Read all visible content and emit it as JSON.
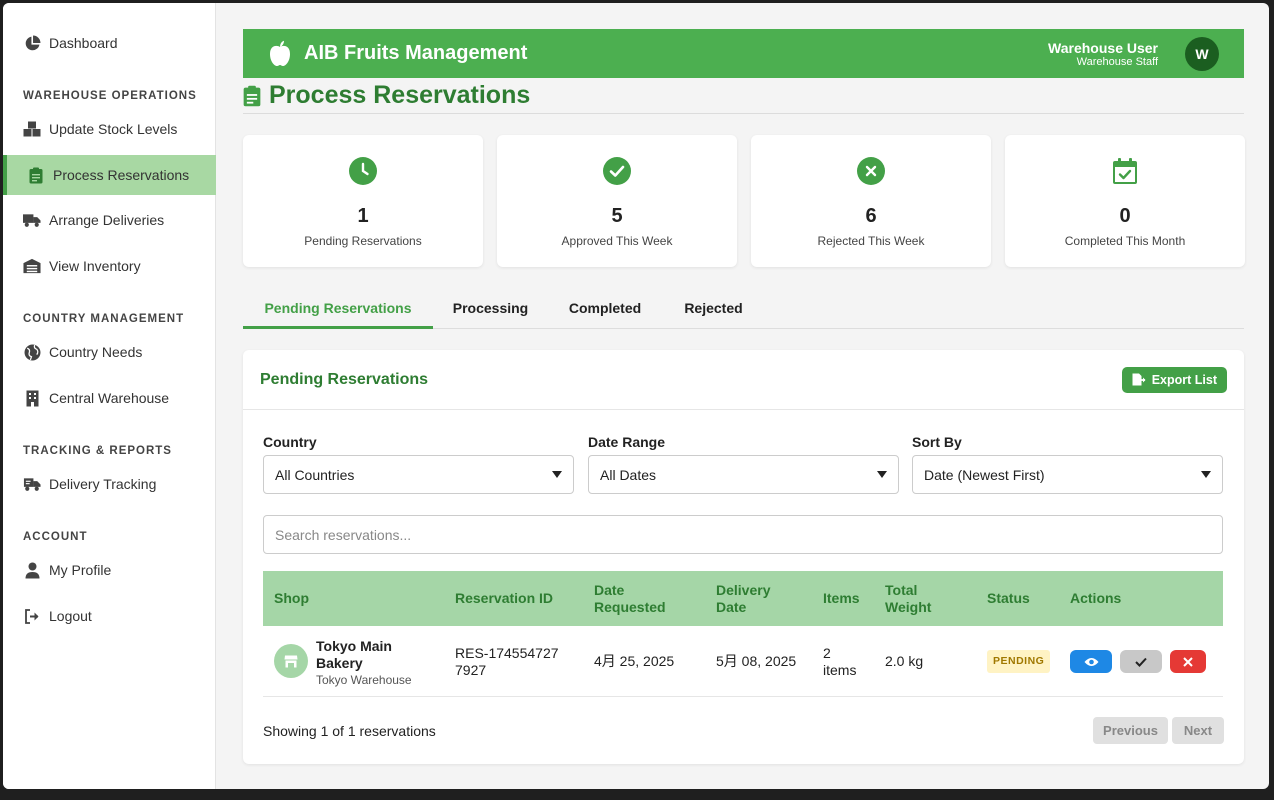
{
  "sidebar": {
    "items": [
      {
        "label": "Dashboard",
        "icon": "pie-chart-icon"
      },
      {
        "label": "Update Stock Levels",
        "icon": "boxes-icon"
      },
      {
        "label": "Process Reservations",
        "icon": "clipboard-icon"
      },
      {
        "label": "Arrange Deliveries",
        "icon": "truck-icon"
      },
      {
        "label": "View Inventory",
        "icon": "warehouse-icon"
      },
      {
        "label": "Country Needs",
        "icon": "globe-icon"
      },
      {
        "label": "Central Warehouse",
        "icon": "building-icon"
      },
      {
        "label": "Delivery Tracking",
        "icon": "truck-fast-icon"
      },
      {
        "label": "My Profile",
        "icon": "user-icon"
      },
      {
        "label": "Logout",
        "icon": "logout-icon"
      }
    ],
    "sections": [
      "WAREHOUSE OPERATIONS",
      "COUNTRY MANAGEMENT",
      "TRACKING & REPORTS",
      "ACCOUNT"
    ],
    "active_index": 2
  },
  "header": {
    "brand": "AIB Fruits Management",
    "user_name": "Warehouse User",
    "user_role": "Warehouse Staff",
    "avatar_letter": "W"
  },
  "page": {
    "title": "Process Reservations"
  },
  "stats": [
    {
      "value": "1",
      "label": "Pending Reservations",
      "icon": "clock-icon"
    },
    {
      "value": "5",
      "label": "Approved This Week",
      "icon": "check-circle-icon"
    },
    {
      "value": "6",
      "label": "Rejected This Week",
      "icon": "x-circle-icon"
    },
    {
      "value": "0",
      "label": "Completed This Month",
      "icon": "calendar-check-icon"
    }
  ],
  "tabs": [
    "Pending Reservations",
    "Processing",
    "Completed",
    "Rejected"
  ],
  "card": {
    "title": "Pending Reservations",
    "export_label": "Export List"
  },
  "filters": {
    "country_label": "Country",
    "country_value": "All Countries",
    "date_label": "Date Range",
    "date_value": "All Dates",
    "sort_label": "Sort By",
    "sort_value": "Date (Newest First)"
  },
  "search": {
    "placeholder": "Search reservations..."
  },
  "table": {
    "headers": [
      "Shop",
      "Reservation ID",
      "Date Requested",
      "Delivery Date",
      "Items",
      "Total Weight",
      "Status",
      "Actions"
    ],
    "rows": [
      {
        "shop_name": "Tokyo Main Bakery",
        "shop_location": "Tokyo Warehouse",
        "reservation_id": "RES-1745547277927",
        "date_requested": "4月 25, 2025",
        "delivery_date": "5月 08, 2025",
        "items": "2 items",
        "total_weight": "2.0 kg",
        "status": "PENDING"
      }
    ]
  },
  "pagination": {
    "summary": "Showing 1 of 1 reservations",
    "prev_label": "Previous",
    "next_label": "Next"
  },
  "colors": {
    "primary": "#4caf50",
    "primary_dark": "#2e7d32",
    "view_button": "#1e88e5",
    "reject_button": "#e53935"
  }
}
